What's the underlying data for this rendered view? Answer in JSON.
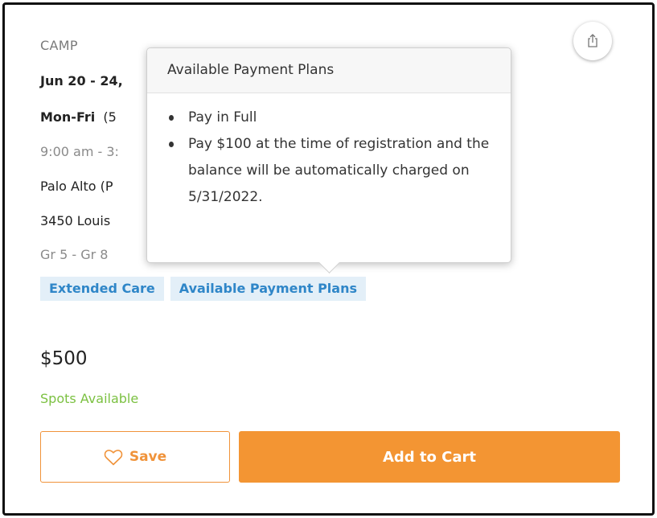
{
  "event": {
    "category": "CAMP",
    "dates": "Jun 20 - 24,",
    "days_bold": "Mon-Fri",
    "days_rest": "(5",
    "time": "9:00 am - 3:",
    "location": "Palo Alto (P",
    "address": "3450 Louis",
    "grades": "Gr 5 - Gr 8"
  },
  "tags": {
    "extended_care": "Extended Care",
    "payment_plans": "Available Payment Plans"
  },
  "price": "$500",
  "availability": "Spots Available",
  "actions": {
    "save_label": "Save",
    "add_to_cart_label": "Add to Cart"
  },
  "tooltip": {
    "title": "Available Payment Plans",
    "items": [
      "Pay in Full",
      "Pay $100 at the time of registration and the balance will be automatically charged on 5/31/2022."
    ]
  },
  "icons": {
    "share": "share-icon",
    "save": "heart-icon"
  },
  "colors": {
    "accent": "#f39533",
    "tag_text": "#2f86c8",
    "tag_bg": "#e3eff8",
    "available": "#7cc142"
  }
}
